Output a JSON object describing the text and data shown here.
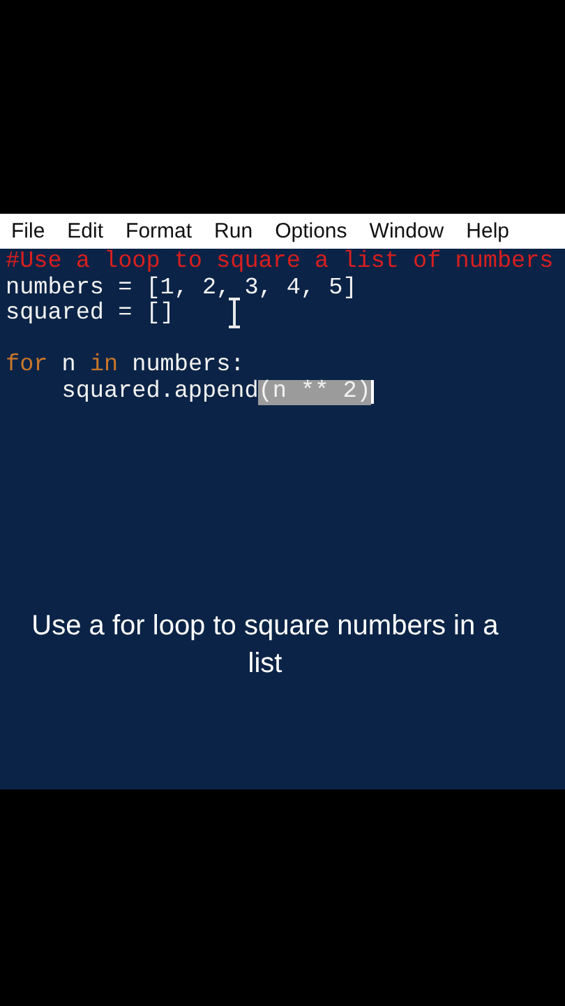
{
  "menu": [
    {
      "label": "File"
    },
    {
      "label": "Edit"
    },
    {
      "label": "Format"
    },
    {
      "label": "Run"
    },
    {
      "label": "Options"
    },
    {
      "label": "Window"
    },
    {
      "label": "Help"
    }
  ],
  "editor": {
    "lines": [
      {
        "kind": "code",
        "tokens": [
          {
            "text": "#Use a loop to square a list of numbers",
            "kind": "comment",
            "selected": false
          }
        ]
      },
      {
        "kind": "code",
        "tokens": [
          {
            "text": "numbers = [1, 2, 3, 4, 5]",
            "kind": "plain",
            "selected": false
          }
        ]
      },
      {
        "kind": "code",
        "tokens": [
          {
            "text": "squared = []",
            "kind": "plain",
            "selected": false
          }
        ]
      },
      {
        "kind": "blank"
      },
      {
        "kind": "code",
        "tokens": [
          {
            "text": "for",
            "kind": "keyword",
            "selected": false
          },
          {
            "text": " n ",
            "kind": "plain",
            "selected": false
          },
          {
            "text": "in",
            "kind": "keyword",
            "selected": false
          },
          {
            "text": " numbers:",
            "kind": "plain",
            "selected": false
          }
        ]
      },
      {
        "kind": "code",
        "tokens": [
          {
            "text": "    squared.append",
            "kind": "plain",
            "selected": false
          },
          {
            "text": "(n ** 2)",
            "kind": "plain",
            "selected": true
          }
        ]
      }
    ]
  },
  "caption": "Use a for loop to square numbers in a list"
}
